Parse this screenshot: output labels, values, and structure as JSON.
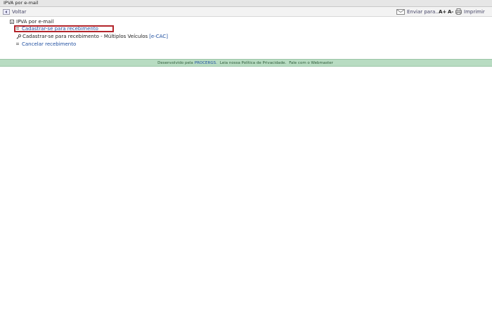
{
  "window": {
    "title": "IPVA por e-mail"
  },
  "toolbar": {
    "back_label": "Voltar",
    "send_label": "Enviar para...",
    "font_increase_label": "A+",
    "font_decrease_label": "A-",
    "print_label": "Imprimir"
  },
  "tree": {
    "root_label": "IPVA por e-mail",
    "items": [
      {
        "label": "Cadastrar-se para recebimento"
      },
      {
        "label": "Cadastrar-se para recebimento - Múltiplos Veículos",
        "suffix": "[e-CAC]"
      },
      {
        "label": "Cancelar recebimento"
      }
    ]
  },
  "footer": {
    "prefix": "Desenvolvido pela",
    "company": "PROCERGS.",
    "privacy": "Leia nossa Política de Privacidade.",
    "contact": "Fale com o Webmaster"
  },
  "colors": {
    "highlight": "#b3242a",
    "footer_bg": "#b8dcc2",
    "link": "#1f4fa0"
  }
}
